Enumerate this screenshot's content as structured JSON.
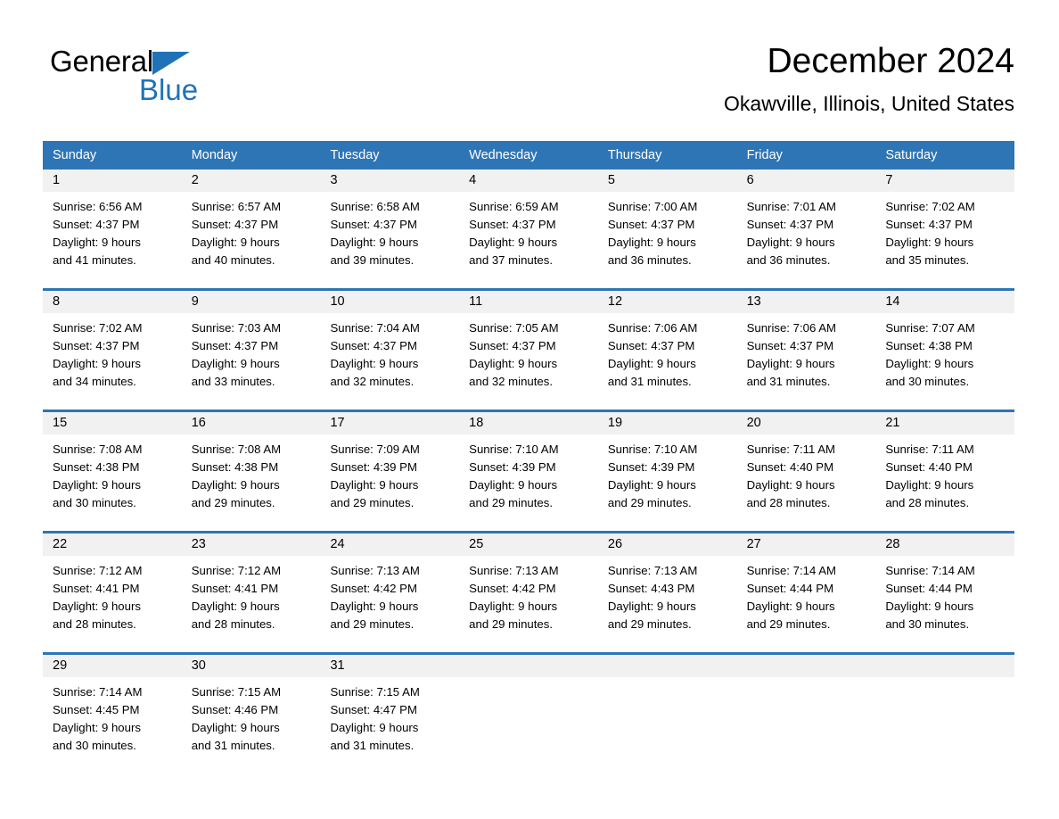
{
  "brand": {
    "name_part1": "General",
    "name_part2": "Blue",
    "triangle_color": "#1f72b8",
    "logo_icon": "triangle-sail-icon"
  },
  "header": {
    "title": "December 2024",
    "subtitle": "Okawville, Illinois, United States"
  },
  "theme": {
    "header_blue": "#2e75b6",
    "day_number_band": "#f1f1f1",
    "text": "#000000",
    "brand_blue": "#1f72b8"
  },
  "calendar": {
    "weekdays": [
      "Sunday",
      "Monday",
      "Tuesday",
      "Wednesday",
      "Thursday",
      "Friday",
      "Saturday"
    ],
    "weeks": [
      [
        {
          "day": "1",
          "sunrise": "Sunrise: 6:56 AM",
          "sunset": "Sunset: 4:37 PM",
          "daylight_line1": "Daylight: 9 hours",
          "daylight_line2": "and 41 minutes."
        },
        {
          "day": "2",
          "sunrise": "Sunrise: 6:57 AM",
          "sunset": "Sunset: 4:37 PM",
          "daylight_line1": "Daylight: 9 hours",
          "daylight_line2": "and 40 minutes."
        },
        {
          "day": "3",
          "sunrise": "Sunrise: 6:58 AM",
          "sunset": "Sunset: 4:37 PM",
          "daylight_line1": "Daylight: 9 hours",
          "daylight_line2": "and 39 minutes."
        },
        {
          "day": "4",
          "sunrise": "Sunrise: 6:59 AM",
          "sunset": "Sunset: 4:37 PM",
          "daylight_line1": "Daylight: 9 hours",
          "daylight_line2": "and 37 minutes."
        },
        {
          "day": "5",
          "sunrise": "Sunrise: 7:00 AM",
          "sunset": "Sunset: 4:37 PM",
          "daylight_line1": "Daylight: 9 hours",
          "daylight_line2": "and 36 minutes."
        },
        {
          "day": "6",
          "sunrise": "Sunrise: 7:01 AM",
          "sunset": "Sunset: 4:37 PM",
          "daylight_line1": "Daylight: 9 hours",
          "daylight_line2": "and 36 minutes."
        },
        {
          "day": "7",
          "sunrise": "Sunrise: 7:02 AM",
          "sunset": "Sunset: 4:37 PM",
          "daylight_line1": "Daylight: 9 hours",
          "daylight_line2": "and 35 minutes."
        }
      ],
      [
        {
          "day": "8",
          "sunrise": "Sunrise: 7:02 AM",
          "sunset": "Sunset: 4:37 PM",
          "daylight_line1": "Daylight: 9 hours",
          "daylight_line2": "and 34 minutes."
        },
        {
          "day": "9",
          "sunrise": "Sunrise: 7:03 AM",
          "sunset": "Sunset: 4:37 PM",
          "daylight_line1": "Daylight: 9 hours",
          "daylight_line2": "and 33 minutes."
        },
        {
          "day": "10",
          "sunrise": "Sunrise: 7:04 AM",
          "sunset": "Sunset: 4:37 PM",
          "daylight_line1": "Daylight: 9 hours",
          "daylight_line2": "and 32 minutes."
        },
        {
          "day": "11",
          "sunrise": "Sunrise: 7:05 AM",
          "sunset": "Sunset: 4:37 PM",
          "daylight_line1": "Daylight: 9 hours",
          "daylight_line2": "and 32 minutes."
        },
        {
          "day": "12",
          "sunrise": "Sunrise: 7:06 AM",
          "sunset": "Sunset: 4:37 PM",
          "daylight_line1": "Daylight: 9 hours",
          "daylight_line2": "and 31 minutes."
        },
        {
          "day": "13",
          "sunrise": "Sunrise: 7:06 AM",
          "sunset": "Sunset: 4:37 PM",
          "daylight_line1": "Daylight: 9 hours",
          "daylight_line2": "and 31 minutes."
        },
        {
          "day": "14",
          "sunrise": "Sunrise: 7:07 AM",
          "sunset": "Sunset: 4:38 PM",
          "daylight_line1": "Daylight: 9 hours",
          "daylight_line2": "and 30 minutes."
        }
      ],
      [
        {
          "day": "15",
          "sunrise": "Sunrise: 7:08 AM",
          "sunset": "Sunset: 4:38 PM",
          "daylight_line1": "Daylight: 9 hours",
          "daylight_line2": "and 30 minutes."
        },
        {
          "day": "16",
          "sunrise": "Sunrise: 7:08 AM",
          "sunset": "Sunset: 4:38 PM",
          "daylight_line1": "Daylight: 9 hours",
          "daylight_line2": "and 29 minutes."
        },
        {
          "day": "17",
          "sunrise": "Sunrise: 7:09 AM",
          "sunset": "Sunset: 4:39 PM",
          "daylight_line1": "Daylight: 9 hours",
          "daylight_line2": "and 29 minutes."
        },
        {
          "day": "18",
          "sunrise": "Sunrise: 7:10 AM",
          "sunset": "Sunset: 4:39 PM",
          "daylight_line1": "Daylight: 9 hours",
          "daylight_line2": "and 29 minutes."
        },
        {
          "day": "19",
          "sunrise": "Sunrise: 7:10 AM",
          "sunset": "Sunset: 4:39 PM",
          "daylight_line1": "Daylight: 9 hours",
          "daylight_line2": "and 29 minutes."
        },
        {
          "day": "20",
          "sunrise": "Sunrise: 7:11 AM",
          "sunset": "Sunset: 4:40 PM",
          "daylight_line1": "Daylight: 9 hours",
          "daylight_line2": "and 28 minutes."
        },
        {
          "day": "21",
          "sunrise": "Sunrise: 7:11 AM",
          "sunset": "Sunset: 4:40 PM",
          "daylight_line1": "Daylight: 9 hours",
          "daylight_line2": "and 28 minutes."
        }
      ],
      [
        {
          "day": "22",
          "sunrise": "Sunrise: 7:12 AM",
          "sunset": "Sunset: 4:41 PM",
          "daylight_line1": "Daylight: 9 hours",
          "daylight_line2": "and 28 minutes."
        },
        {
          "day": "23",
          "sunrise": "Sunrise: 7:12 AM",
          "sunset": "Sunset: 4:41 PM",
          "daylight_line1": "Daylight: 9 hours",
          "daylight_line2": "and 28 minutes."
        },
        {
          "day": "24",
          "sunrise": "Sunrise: 7:13 AM",
          "sunset": "Sunset: 4:42 PM",
          "daylight_line1": "Daylight: 9 hours",
          "daylight_line2": "and 29 minutes."
        },
        {
          "day": "25",
          "sunrise": "Sunrise: 7:13 AM",
          "sunset": "Sunset: 4:42 PM",
          "daylight_line1": "Daylight: 9 hours",
          "daylight_line2": "and 29 minutes."
        },
        {
          "day": "26",
          "sunrise": "Sunrise: 7:13 AM",
          "sunset": "Sunset: 4:43 PM",
          "daylight_line1": "Daylight: 9 hours",
          "daylight_line2": "and 29 minutes."
        },
        {
          "day": "27",
          "sunrise": "Sunrise: 7:14 AM",
          "sunset": "Sunset: 4:44 PM",
          "daylight_line1": "Daylight: 9 hours",
          "daylight_line2": "and 29 minutes."
        },
        {
          "day": "28",
          "sunrise": "Sunrise: 7:14 AM",
          "sunset": "Sunset: 4:44 PM",
          "daylight_line1": "Daylight: 9 hours",
          "daylight_line2": "and 30 minutes."
        }
      ],
      [
        {
          "day": "29",
          "sunrise": "Sunrise: 7:14 AM",
          "sunset": "Sunset: 4:45 PM",
          "daylight_line1": "Daylight: 9 hours",
          "daylight_line2": "and 30 minutes."
        },
        {
          "day": "30",
          "sunrise": "Sunrise: 7:15 AM",
          "sunset": "Sunset: 4:46 PM",
          "daylight_line1": "Daylight: 9 hours",
          "daylight_line2": "and 31 minutes."
        },
        {
          "day": "31",
          "sunrise": "Sunrise: 7:15 AM",
          "sunset": "Sunset: 4:47 PM",
          "daylight_line1": "Daylight: 9 hours",
          "daylight_line2": "and 31 minutes."
        },
        {
          "day": "",
          "sunrise": "",
          "sunset": "",
          "daylight_line1": "",
          "daylight_line2": ""
        },
        {
          "day": "",
          "sunrise": "",
          "sunset": "",
          "daylight_line1": "",
          "daylight_line2": ""
        },
        {
          "day": "",
          "sunrise": "",
          "sunset": "",
          "daylight_line1": "",
          "daylight_line2": ""
        },
        {
          "day": "",
          "sunrise": "",
          "sunset": "",
          "daylight_line1": "",
          "daylight_line2": ""
        }
      ]
    ]
  }
}
